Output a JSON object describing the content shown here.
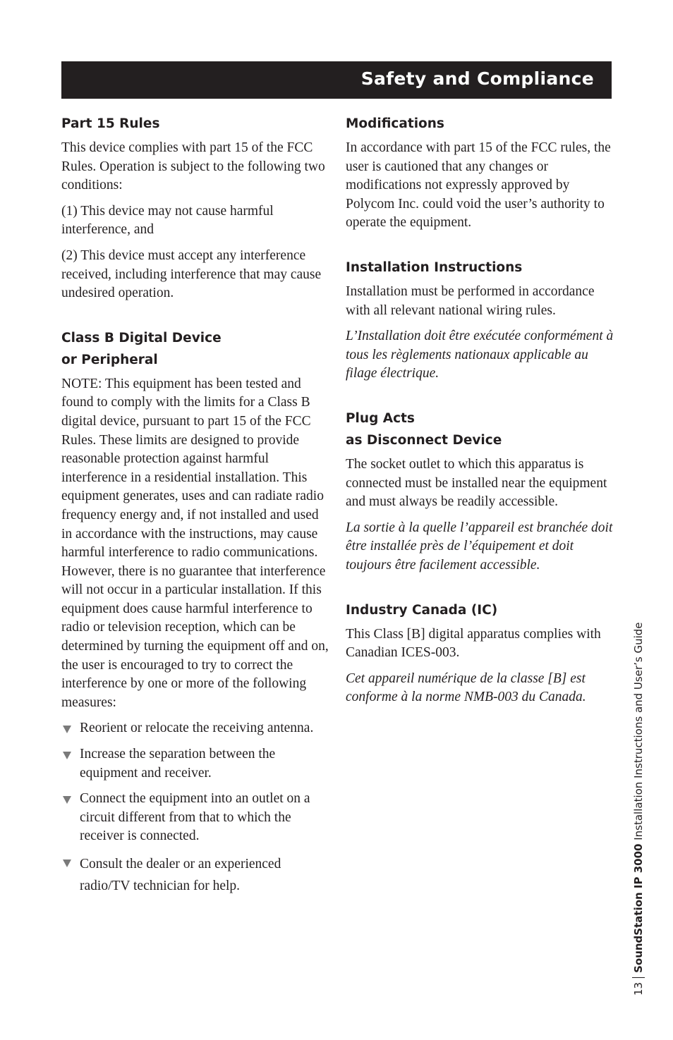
{
  "header": {
    "title": "Safety and Compliance"
  },
  "left_column": {
    "part15": {
      "heading": "Part 15 Rules",
      "paragraphs": [
        "This device complies with part 15 of the FCC Rules. Operation is subject to the following two conditions:",
        "(1) This device may not cause harmful interference, and",
        "(2) This device must accept any interference received, including interference that may cause undesired operation."
      ]
    },
    "classb": {
      "heading_line1": "Class B Digital Device",
      "heading_line2": "or Peripheral",
      "paragraph": "NOTE: This equipment has been tested and found to comply with the limits for a Class B digital device, pursuant to part 15 of the FCC Rules. These limits are designed to provide reasonable protection against harmful interference in a residential installation. This equipment generates, uses and can radiate radio frequency energy and, if not installed and used in accordance with the instructions, may cause harmful interference to radio communications. However, there is no guarantee that interference will not occur in a particular installation. If this equipment does cause harmful interference to radio or television reception, which can be determined by turning the equipment off and on, the user is encouraged to try to correct the interference by one or more of the following measures:",
      "measures": [
        "Reorient or relocate the receiving antenna.",
        "Increase the separation between the equipment and receiver.",
        "Connect the equipment into an outlet on a circuit different from that to which the receiver is connected.",
        "Consult the dealer or an experienced radio/TV technician for help."
      ]
    }
  },
  "right_column": {
    "modifications": {
      "heading": "Modifications",
      "paragraph": "In accordance with part 15 of the FCC rules, the user is cautioned that any changes or modifications not expressly approved by Polycom Inc. could void the user’s authority to operate the equipment."
    },
    "installation": {
      "heading": "Installation Instructions",
      "paragraph": "Installation must be performed in accordance with all relevant national wiring rules.",
      "paragraph_fr": "L’Installation doit être exécutée conformément à tous les règlements nationaux applicable au filage électrique."
    },
    "plug": {
      "heading_line1": "Plug Acts",
      "heading_line2": "as Disconnect Device",
      "paragraph": "The socket outlet to which this apparatus is connected must be installed near the equipment and must always be readily accessible.",
      "paragraph_fr": "La sortie à la quelle l’appareil est branchée doit être installée près de l’équipement et doit toujours être facilement accessible."
    },
    "canada": {
      "heading": "Industry Canada (IC)",
      "paragraph": "This Class [B] digital apparatus complies with Canadian ICES-003.",
      "paragraph_fr": "Cet appareil numérique de la classe [B] est conforme à la norme NMB-003 du Canada."
    }
  },
  "footer": {
    "page_number": "13",
    "product_bold": "SoundStation IP 3000",
    "guide_title": " Installation Instructions and User’s Guide"
  }
}
